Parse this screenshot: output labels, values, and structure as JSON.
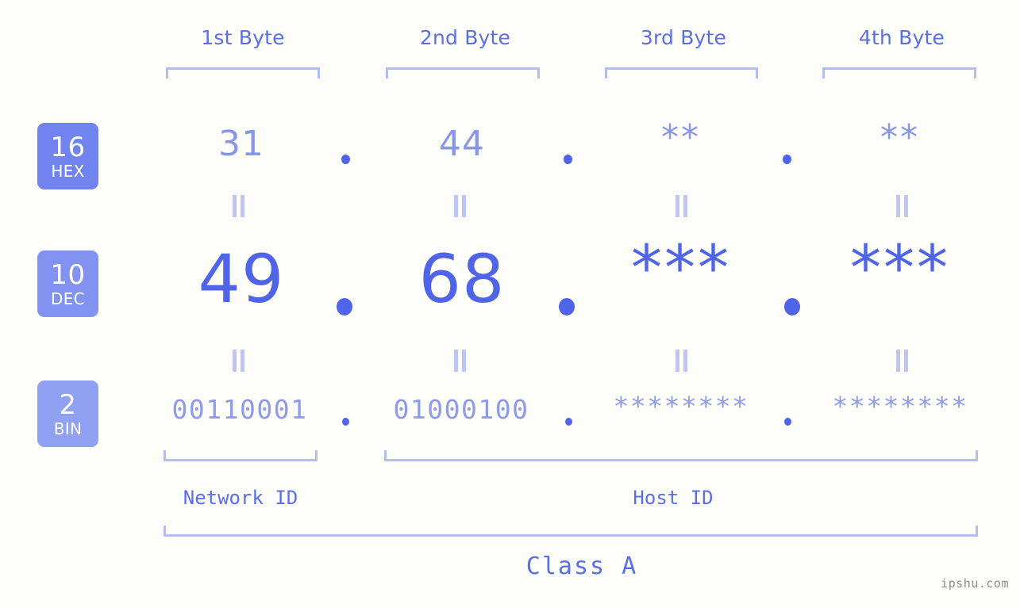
{
  "meta": {
    "watermark": "ipshu.com"
  },
  "columns": [
    {
      "header": "1st Byte"
    },
    {
      "header": "2nd Byte"
    },
    {
      "header": "3rd Byte"
    },
    {
      "header": "4th Byte"
    }
  ],
  "rows": [
    {
      "badge": {
        "number": "16",
        "abbr": "HEX",
        "color": "#7083ef"
      },
      "values": [
        "31",
        "44",
        "**",
        "**"
      ],
      "separator": "."
    },
    {
      "badge": {
        "number": "10",
        "abbr": "DEC",
        "color": "#8192f0"
      },
      "values": [
        "49",
        "68",
        "***",
        "***"
      ],
      "separator": "."
    },
    {
      "badge": {
        "number": "2",
        "abbr": "BIN",
        "color": "#90a0f3"
      },
      "values": [
        "00110001",
        "01000100",
        "********",
        "********"
      ],
      "separator": "."
    }
  ],
  "equals_symbol": "=",
  "groups": {
    "network_id": "Network ID",
    "host_id": "Host ID",
    "class": "Class A"
  },
  "colors": {
    "background": "#fdfdfa",
    "accent": "#4f64e8",
    "accent_light": "#8896ea",
    "bracket": "#b3bdf2",
    "label": "#5a6ee8"
  }
}
